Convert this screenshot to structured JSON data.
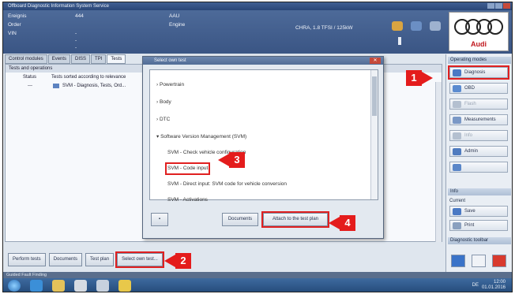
{
  "window": {
    "title": "Offboard Diagnostic Information System Service"
  },
  "header": {
    "cells": [
      {
        "label": "Ereignis",
        "value": "444"
      },
      {
        "label": "Order",
        "value": ""
      },
      {
        "label": "VIN",
        "value": "---"
      },
      {
        "label": "AAU",
        "value": ""
      },
      {
        "label": "Engine",
        "value": ""
      },
      {
        "label": "",
        "value": "CHRA, 1.8 TFSI / 125kW"
      }
    ],
    "brand": "Audi"
  },
  "tabs": [
    "Control modules",
    "Events",
    "DISS",
    "TPI",
    "Tests"
  ],
  "main": {
    "title": "Tests and operations",
    "column_status": "Status",
    "column_tests": "Tests sorted according to relevance",
    "row1_status": "---",
    "row1_text": "SVM - Diagnosis, Tests, Ord..."
  },
  "bottom_buttons": [
    "Perform tests",
    "Documents",
    "Test plan",
    "Select own test..."
  ],
  "status_bar": "Guided Fault Finding",
  "right_panel": {
    "title": "Operating modes",
    "buttons": [
      "Diagnosis",
      "OBD",
      "Flash",
      "Measurements",
      "Info",
      "Admin"
    ],
    "second_title": "Info",
    "section_label": "Current",
    "section_buttons": [
      "Save",
      "Print"
    ],
    "third_title": "Diagnostic toolbar"
  },
  "dialog": {
    "title": "Select own test",
    "items": [
      "Powertrain",
      "Body",
      "DTC",
      "Software Version Management (SVM)",
      "SVM - Check vehicle configuration",
      "SVM - Code input",
      "SVM - Direct input: SVM code for vehicle conversion",
      "SVM - Activations"
    ],
    "btn_left_icon": "documents-icon",
    "btn_documents": "Documents",
    "btn_add": "Attach to the test plan"
  },
  "callouts": [
    "1",
    "2",
    "3",
    "4"
  ],
  "taskbar": {
    "tray": "DE",
    "time": "12:00",
    "date": "01.01.2016"
  },
  "colors": {
    "callout_red": "#e41c1c",
    "header_blue": "#3f5f92",
    "audi_red": "#c0171d"
  }
}
